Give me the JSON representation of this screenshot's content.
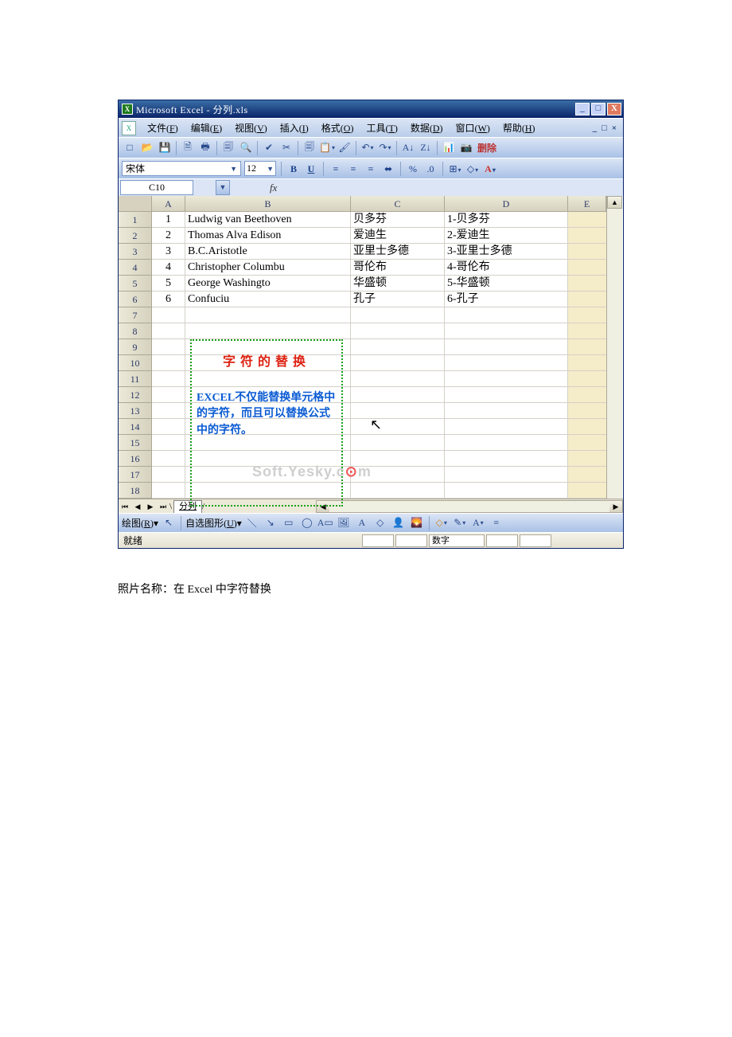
{
  "title": "Microsoft Excel - 分列.xls",
  "winbtns": {
    "min": "_",
    "max": "□",
    "close": "X"
  },
  "menu": [
    {
      "label": "文件",
      "key": "F"
    },
    {
      "label": "编辑",
      "key": "E"
    },
    {
      "label": "视图",
      "key": "V"
    },
    {
      "label": "插入",
      "key": "I"
    },
    {
      "label": "格式",
      "key": "O"
    },
    {
      "label": "工具",
      "key": "T"
    },
    {
      "label": "数据",
      "key": "D"
    },
    {
      "label": "窗口",
      "key": "W"
    },
    {
      "label": "帮助",
      "key": "H"
    }
  ],
  "toolbar_delete": "删除",
  "font": {
    "name": "宋体",
    "size": "12"
  },
  "namebox": "C10",
  "fx_label": "fx",
  "cols": [
    "A",
    "B",
    "C",
    "D",
    "E"
  ],
  "rows": [
    "1",
    "2",
    "3",
    "4",
    "5",
    "6",
    "7",
    "8",
    "9",
    "10",
    "11",
    "12",
    "13",
    "14",
    "15",
    "16",
    "17",
    "18"
  ],
  "data": [
    {
      "a": "1",
      "b": "Ludwig van Beethoven",
      "c": "贝多芬",
      "d": "1-贝多芬"
    },
    {
      "a": "2",
      "b": "Thomas Alva Edison",
      "c": "爱迪生",
      "d": "2-爱迪生"
    },
    {
      "a": "3",
      "b": "B.C.Aristotle",
      "c": "亚里士多德",
      "d": "3-亚里士多德"
    },
    {
      "a": "4",
      "b": "Christopher Columbu",
      "c": "哥伦布",
      "d": "4-哥伦布"
    },
    {
      "a": "5",
      "b": "George Washingto",
      "c": "华盛顿",
      "d": "5-华盛顿"
    },
    {
      "a": "6",
      "b": "Confuciu",
      "c": "孔子",
      "d": "6-孔子"
    }
  ],
  "callout": {
    "title": "字符的替换",
    "body": "EXCEL不仅能替换单元格中的字符，而且可以替换公式中的字符。"
  },
  "watermark": {
    "pre": "Soft.Yesky.c",
    "o": "⊙",
    "post": "m"
  },
  "sheet_tab": "分列",
  "draw": {
    "label": "绘图",
    "key": "R",
    "autoshape": "自选图形",
    "akey": "U"
  },
  "status": {
    "ready": "就绪",
    "mode": "数字"
  },
  "caption": "照片名称：在 Excel 中字符替换"
}
